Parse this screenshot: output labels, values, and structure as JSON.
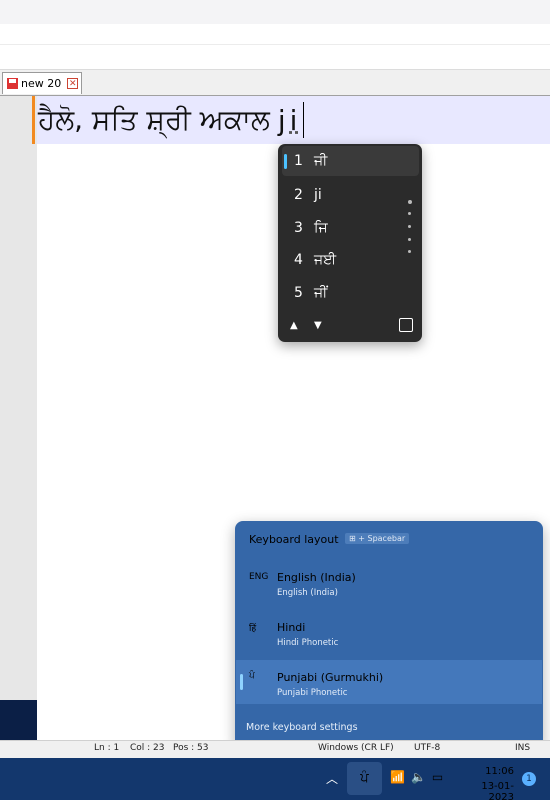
{
  "editor": {
    "tab_label": "new 20",
    "line_text": "ਹੈਲੋ, ਸਤਿ ਸ਼੍ਰੀ ਅਕਾਲ",
    "composing_text": "ji"
  },
  "ime": {
    "candidates": [
      {
        "num": "1",
        "text": "ਜੀ"
      },
      {
        "num": "2",
        "text": "ji"
      },
      {
        "num": "3",
        "text": "ਜਿ"
      },
      {
        "num": "4",
        "text": "ਜਈ"
      },
      {
        "num": "5",
        "text": "ਜੀਂ"
      }
    ],
    "selected_index": 0,
    "up_icon": "triangle-up-icon",
    "down_icon": "triangle-down-icon",
    "favorite_icon": "heart-icon"
  },
  "keyboard_flyout": {
    "title": "Keyboard layout",
    "shortcut_hint": "⊞ + Spacebar",
    "languages": [
      {
        "code": "ENG",
        "name": "English (India)",
        "sub": "English (India)"
      },
      {
        "code": "हिं",
        "name": "Hindi",
        "sub": "Hindi Phonetic"
      },
      {
        "code": "ਪੰ",
        "name": "Punjabi (Gurmukhi)",
        "sub": "Punjabi Phonetic"
      }
    ],
    "selected_language": 2,
    "more_link": "More keyboard settings",
    "accent_color": "#3567a8"
  },
  "statusbar": {
    "ln": "Ln : 1",
    "col": "Col : 23",
    "pos": "Pos : 53",
    "eol": "Windows (CR LF)",
    "encoding": "UTF-8",
    "mode": "INS"
  },
  "taskbar": {
    "ime_indicator": "ਪੰ",
    "time": "11:06",
    "date": "13-01-2023",
    "notification_count": "1"
  }
}
